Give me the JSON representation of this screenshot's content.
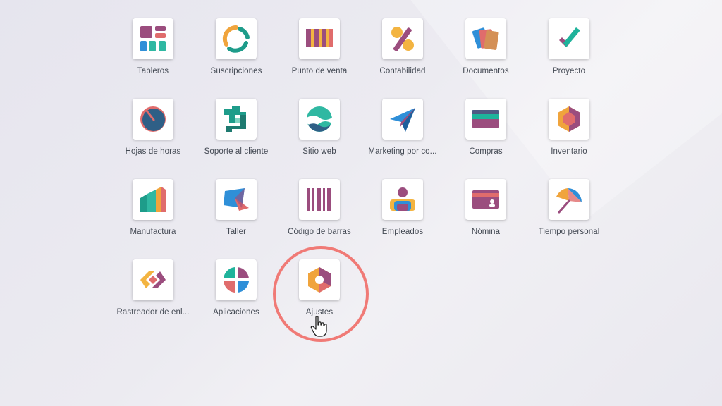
{
  "apps": [
    {
      "label": "Tableros",
      "icon": "dashboards-icon"
    },
    {
      "label": "Suscripciones",
      "icon": "subscriptions-icon"
    },
    {
      "label": "Punto de venta",
      "icon": "point-of-sale-icon"
    },
    {
      "label": "Contabilidad",
      "icon": "accounting-icon"
    },
    {
      "label": "Documentos",
      "icon": "documents-icon"
    },
    {
      "label": "Proyecto",
      "icon": "project-icon"
    },
    {
      "label": "Hojas de horas",
      "icon": "timesheets-icon"
    },
    {
      "label": "Soporte al cliente",
      "icon": "helpdesk-icon"
    },
    {
      "label": "Sitio web",
      "icon": "website-icon"
    },
    {
      "label": "Marketing por co...",
      "icon": "email-marketing-icon"
    },
    {
      "label": "Compras",
      "icon": "purchase-icon"
    },
    {
      "label": "Inventario",
      "icon": "inventory-icon"
    },
    {
      "label": "Manufactura",
      "icon": "manufacturing-icon"
    },
    {
      "label": "Taller",
      "icon": "workshop-icon"
    },
    {
      "label": "Código de barras",
      "icon": "barcode-icon"
    },
    {
      "label": "Empleados",
      "icon": "employees-icon"
    },
    {
      "label": "Nómina",
      "icon": "payroll-icon"
    },
    {
      "label": "Tiempo personal",
      "icon": "time-off-icon"
    },
    {
      "label": "Rastreador de enl...",
      "icon": "link-tracker-icon"
    },
    {
      "label": "Aplicaciones",
      "icon": "apps-icon"
    },
    {
      "label": "Ajustes",
      "icon": "settings-icon"
    }
  ],
  "highlighted_app": "Ajustes",
  "colors": {
    "highlight_ring": "#f07a76",
    "label_text": "#444a54",
    "tile_background": "#ffffff"
  }
}
